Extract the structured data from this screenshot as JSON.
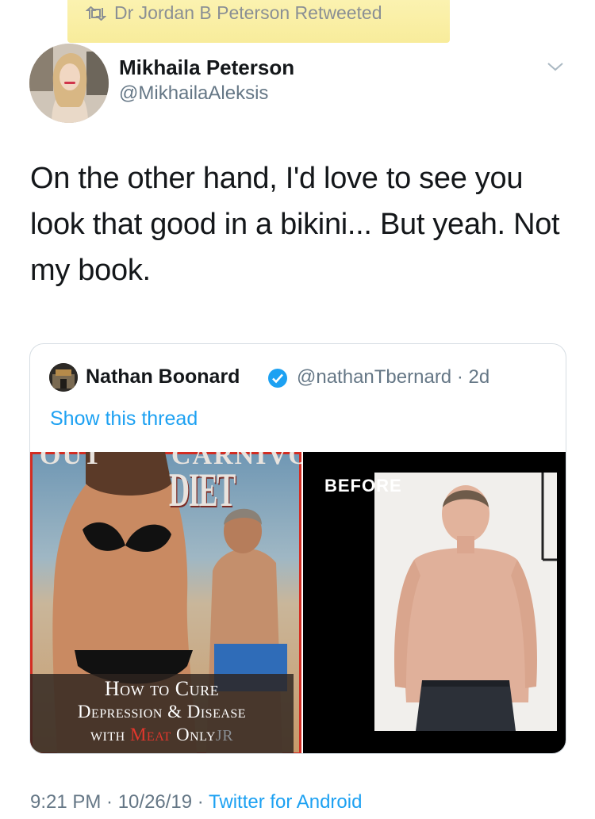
{
  "retweet": {
    "label": "Dr Jordan B Peterson Retweeted",
    "highlight_color": "#f8ec9b"
  },
  "author": {
    "name": "Mikhaila Peterson",
    "handle": "@MikhailaAleksis"
  },
  "tweet": {
    "text": "On the other hand, I'd love to see you look that good in a bikini... But yeah. Not my book."
  },
  "quote": {
    "name": "Nathan Boonard",
    "verified": true,
    "handle_time": "@nathanTbernard · 2d",
    "show_thread": "Show this thread",
    "media": {
      "left": {
        "top_text": "CARNIVORE",
        "top_text_left": "OUT",
        "title_word": "DIET",
        "caption_line1": "How to Cure",
        "caption_line2": "Depression & Disease",
        "caption_with": "with ",
        "caption_meat": "Meat",
        "caption_only": " Only",
        "caption_mark": "JR"
      },
      "right": {
        "label": "BEFORE"
      }
    }
  },
  "footer": {
    "time_date": "9:21 PM · 10/26/19 · ",
    "source": "Twitter for Android"
  },
  "colors": {
    "link": "#1da1f2",
    "muted": "#657786",
    "meat_red": "#e2362c"
  },
  "icons": [
    "retweet-icon",
    "chevron-down-icon",
    "verified-icon"
  ]
}
